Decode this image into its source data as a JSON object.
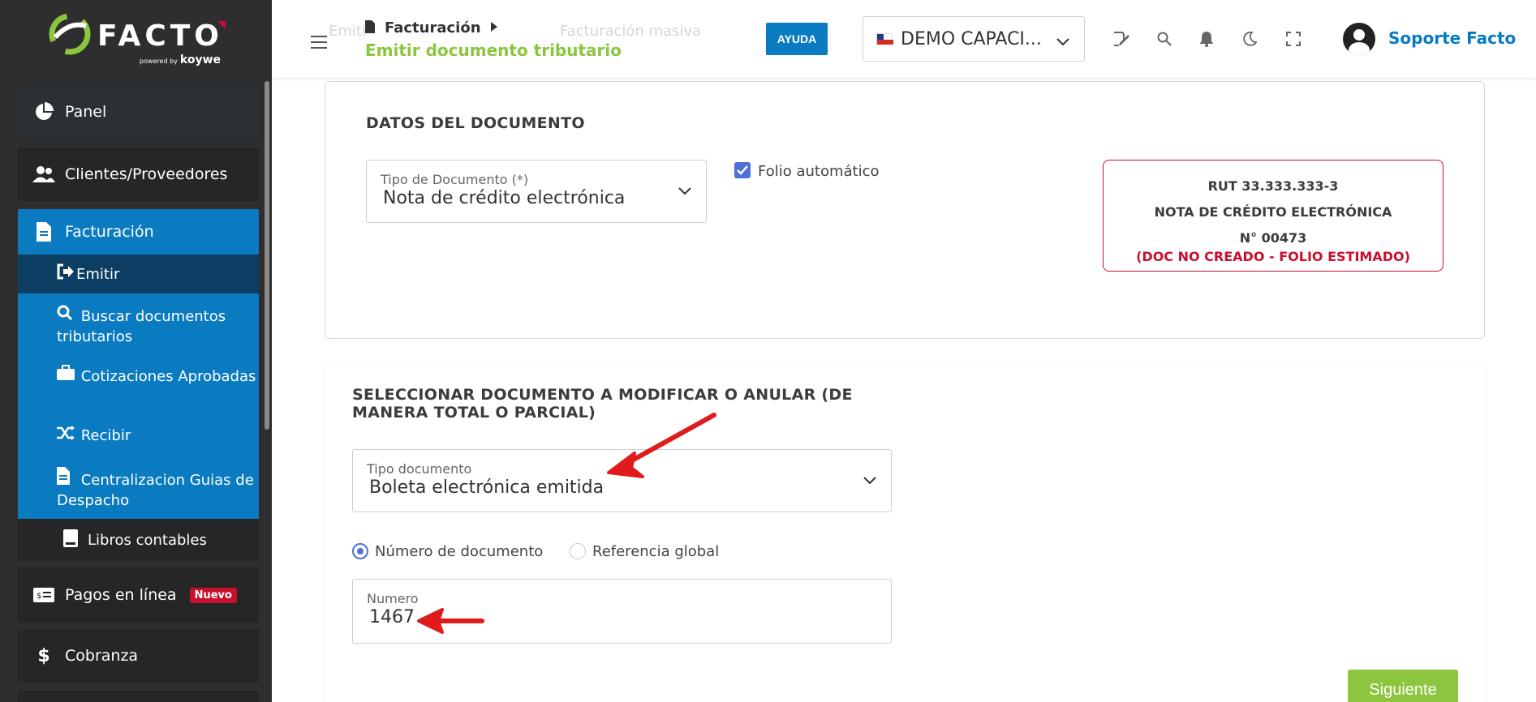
{
  "sidebar": {
    "logo_text": "FACTO",
    "logo_powered": "powered by",
    "logo_brand": "koywe",
    "items": {
      "panel": "Panel",
      "clients": "Clientes/Proveedores",
      "facturacion": "Facturación",
      "pagos": "Pagos en línea",
      "pagos_badge": "Nuevo",
      "cobranza": "Cobranza"
    },
    "submenu": {
      "emitir": "Emitir",
      "buscar": "Buscar documentos tributarios",
      "cotizaciones": "Cotizaciones Aprobadas",
      "recibir": "Recibir",
      "centralizacion": "Centralizacion Guias de Despacho",
      "libros": "Libros contables"
    }
  },
  "header": {
    "breadcrumb_section": "Facturación",
    "subtitle": "Emitir documento tributario",
    "ayuda": "AYUDA",
    "company": "DEMO CAPACI...",
    "user": "Soporte Facto",
    "ghost_left": "Emitir individual",
    "ghost_right": "Facturación masiva",
    "accent": "#0a7bc1",
    "green": "#8cc63f"
  },
  "datos": {
    "title": "DATOS DEL DOCUMENTO",
    "tipo_label": "Tipo de Documento (*)",
    "tipo_value": "Nota de crédito electrónica",
    "folio_auto": "Folio automático",
    "doc_rut": "RUT 33.333.333-3",
    "doc_type": "NOTA DE CRÉDITO ELECTRÓNICA",
    "doc_num": "N° 00473",
    "doc_status": "(DOC NO CREADO - FOLIO ESTIMADO)"
  },
  "seleccionar": {
    "title_line1": "SELECCIONAR DOCUMENTO A MODIFICAR O ANULAR (DE",
    "title_line2": "MANERA TOTAL O PARCIAL)",
    "tipo_label": "Tipo documento",
    "tipo_value": "Boleta electrónica emitida",
    "radio_numero": "Número de documento",
    "radio_global": "Referencia global",
    "numero_label": "Numero",
    "numero_value": "1467",
    "siguiente": "Siguiente"
  }
}
